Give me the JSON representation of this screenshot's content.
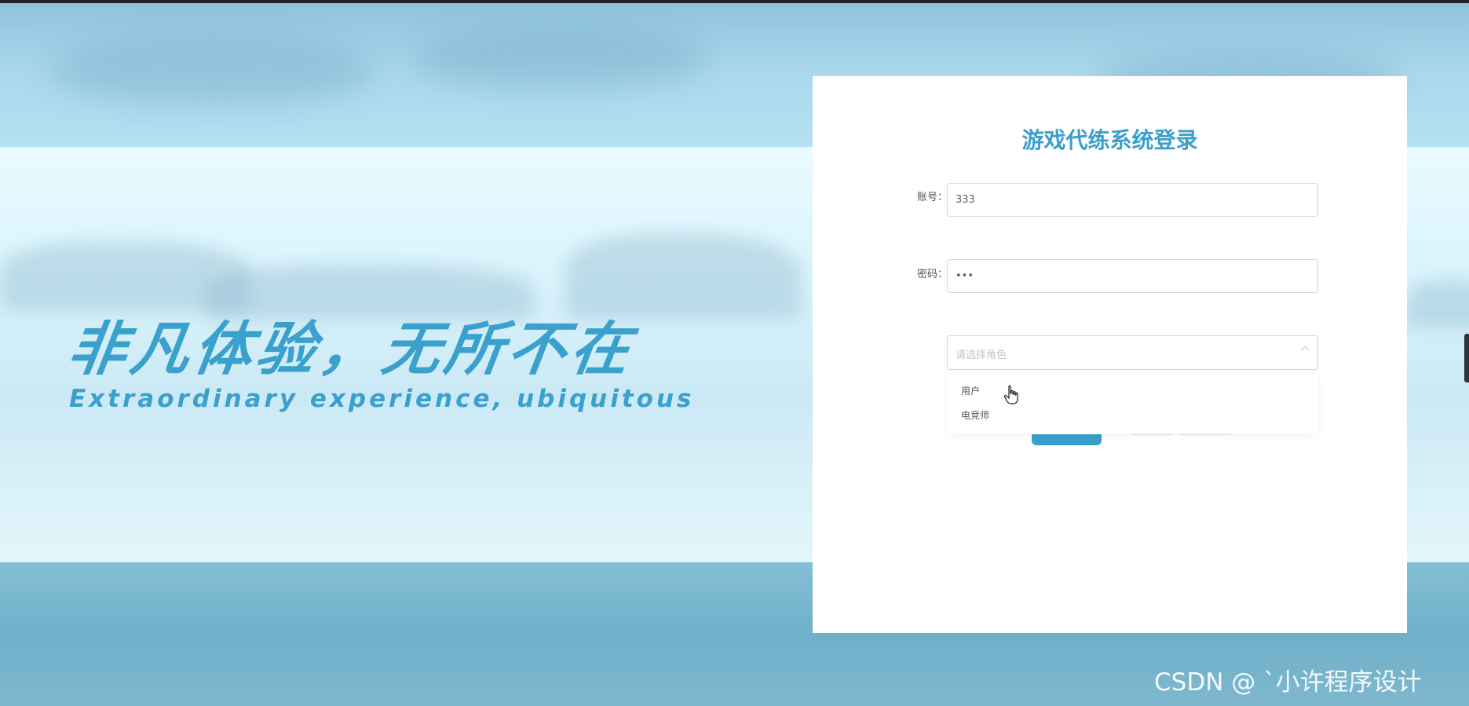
{
  "login": {
    "title": "游戏代练系统登录",
    "account_label": "账号：",
    "account_value": "333",
    "password_label": "密码：",
    "password_value": "•••",
    "role_placeholder": "请选择角色",
    "role_options": [
      "用户",
      "电竞师"
    ]
  },
  "banner": {
    "slogan_cn": "非凡体验，无所不在",
    "slogan_en": "Extraordinary experience, ubiquitous"
  },
  "watermark": "CSDN @ ˋ小许程序设计",
  "colors": {
    "accent": "#3a9fcc",
    "panel": "#ffffff"
  },
  "icons": {
    "select_arrow": "chevron-up-icon",
    "cursor": "hand-pointer-icon"
  }
}
